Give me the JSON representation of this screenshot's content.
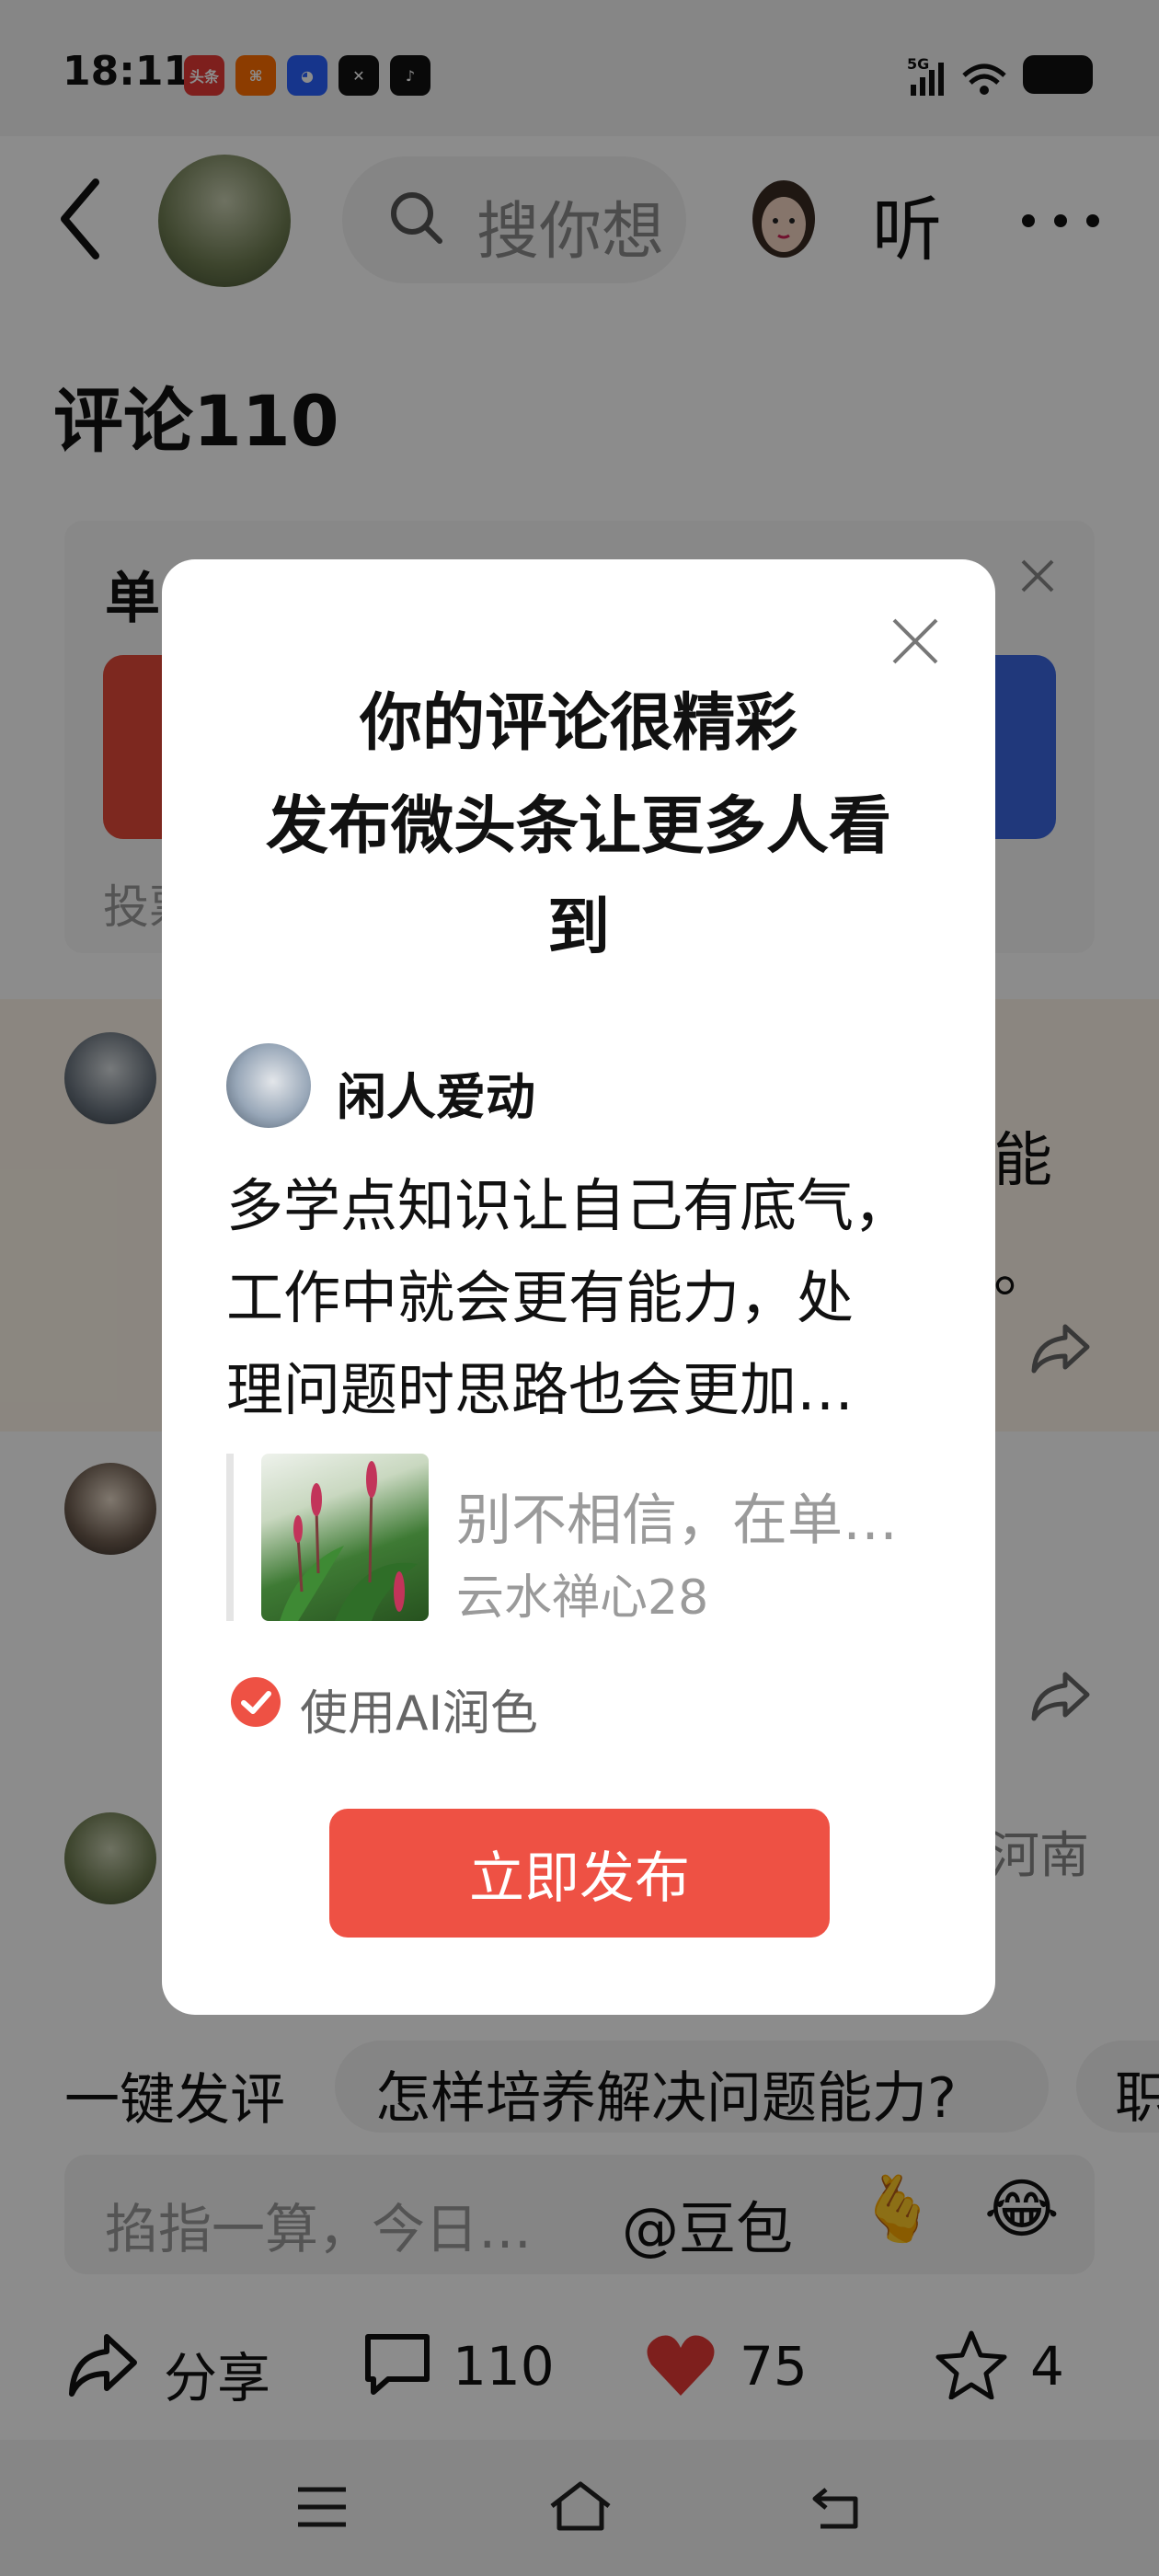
{
  "status_bar": {
    "time": "18:11",
    "apps": [
      {
        "icon": "toutiao-app-icon",
        "label": "头条",
        "color": "#e53935"
      },
      {
        "icon": "app-orange-icon",
        "label": "",
        "color": "#ff6d00"
      },
      {
        "icon": "baidu-app-icon",
        "label": "",
        "color": "#2962ff"
      },
      {
        "icon": "capcut-app-icon",
        "label": "",
        "color": "#111111"
      },
      {
        "icon": "tiktok-app-icon",
        "label": "",
        "color": "#111111"
      }
    ],
    "signal_label": "5G"
  },
  "header": {
    "search_placeholder": "搜你想",
    "listen_label": "听"
  },
  "comments": {
    "title": "评论110"
  },
  "poll": {
    "label": "单",
    "footer": "投票"
  },
  "rows": {
    "row1_right_1": "能",
    "row1_right_2": "。",
    "row3_right": "河南"
  },
  "suggestions": {
    "label": "一键发评",
    "chips": [
      "怎样培养解决问题能力?",
      "职"
    ]
  },
  "input": {
    "placeholder": "掐指一算，今日…",
    "doubao": "@豆包",
    "emojis": [
      "🫰",
      "😂"
    ]
  },
  "actions": {
    "share_label": "分享",
    "comment_count": "110",
    "like_count": "75",
    "favorite_count": "4"
  },
  "modal": {
    "title_lines": [
      "你的评论很精彩",
      "发布微头条让更多人看",
      "到"
    ],
    "author_name": "闲人爱动",
    "body_lines": [
      "多学点知识让自己有底气，",
      "工作中就会更有能力，处",
      "理问题时思路也会更加…"
    ],
    "quote_title": "别不相信，在单…",
    "quote_author": "云水禅心28",
    "ai_label": "使用AI润色",
    "ai_checked": true,
    "publish_label": "立即发布",
    "accent_color": "#ee5144"
  }
}
